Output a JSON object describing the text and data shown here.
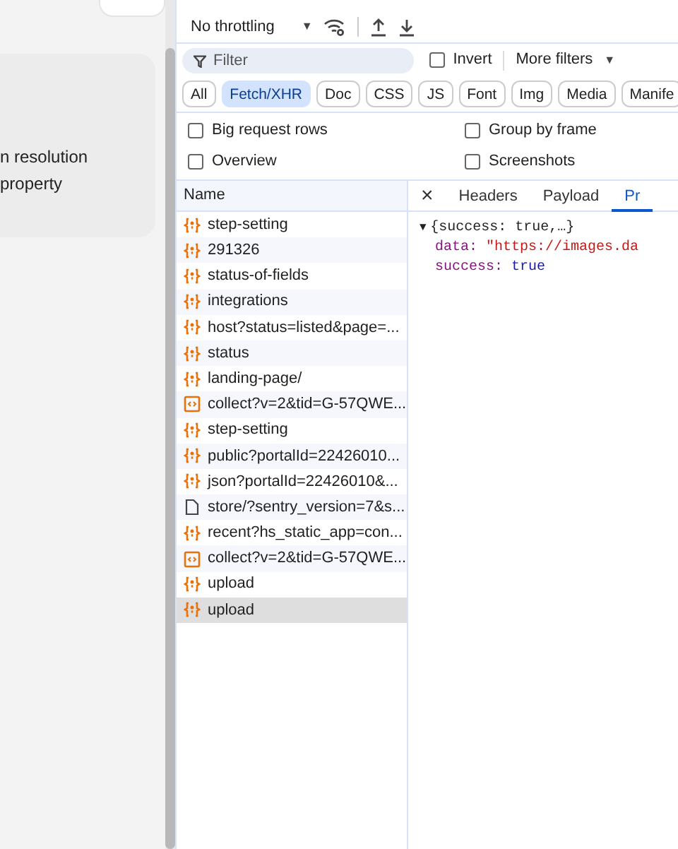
{
  "page": {
    "lines": [
      "n resolution",
      "property"
    ]
  },
  "toolbar": {
    "throttling": "No throttling",
    "caret": "▼"
  },
  "filter": {
    "placeholder": "Filter",
    "invert": {
      "label": "Invert",
      "checked": false
    },
    "more_filters": "More filters",
    "caret": "▼"
  },
  "type_chips": [
    {
      "label": "All",
      "selected": false
    },
    {
      "label": "Fetch/XHR",
      "selected": true
    },
    {
      "label": "Doc",
      "selected": false
    },
    {
      "label": "CSS",
      "selected": false
    },
    {
      "label": "JS",
      "selected": false
    },
    {
      "label": "Font",
      "selected": false
    },
    {
      "label": "Img",
      "selected": false
    },
    {
      "label": "Media",
      "selected": false
    },
    {
      "label": "Manife",
      "selected": false
    }
  ],
  "options": [
    {
      "label": "Big request rows",
      "checked": false
    },
    {
      "label": "Group by frame",
      "checked": false
    },
    {
      "label": "Overview",
      "checked": false
    },
    {
      "label": "Screenshots",
      "checked": false
    }
  ],
  "requests": {
    "column": "Name",
    "rows": [
      {
        "name": "step-setting",
        "kind": "xhr",
        "selected": false
      },
      {
        "name": "291326",
        "kind": "xhr",
        "selected": false
      },
      {
        "name": "status-of-fields",
        "kind": "xhr",
        "selected": false
      },
      {
        "name": "integrations",
        "kind": "xhr",
        "selected": false
      },
      {
        "name": "host?status=listed&page=...",
        "kind": "xhr",
        "selected": false
      },
      {
        "name": "status",
        "kind": "xhr",
        "selected": false
      },
      {
        "name": "landing-page/",
        "kind": "xhr",
        "selected": false
      },
      {
        "name": "collect?v=2&tid=G-57QWE...",
        "kind": "script",
        "selected": false
      },
      {
        "name": "step-setting",
        "kind": "xhr",
        "selected": false
      },
      {
        "name": "public?portalId=22426010...",
        "kind": "xhr",
        "selected": false
      },
      {
        "name": "json?portalId=22426010&...",
        "kind": "xhr",
        "selected": false
      },
      {
        "name": "store/?sentry_version=7&s...",
        "kind": "doc",
        "selected": false
      },
      {
        "name": "recent?hs_static_app=con...",
        "kind": "xhr",
        "selected": false
      },
      {
        "name": "collect?v=2&tid=G-57QWE...",
        "kind": "script",
        "selected": false
      },
      {
        "name": "upload",
        "kind": "xhr",
        "selected": false
      },
      {
        "name": "upload",
        "kind": "xhr",
        "selected": true
      }
    ]
  },
  "detail": {
    "close": "×",
    "tabs": [
      {
        "label": "Headers",
        "selected": false
      },
      {
        "label": "Payload",
        "selected": false
      },
      {
        "label": "Pr",
        "selected": true
      }
    ],
    "preview": {
      "expander": "▼",
      "summary": "{success: true,…}",
      "fields": [
        {
          "key": "data:",
          "value": "\"https://images.da",
          "kind": "string"
        },
        {
          "key": "success:",
          "value": "true",
          "kind": "bool"
        }
      ]
    }
  }
}
